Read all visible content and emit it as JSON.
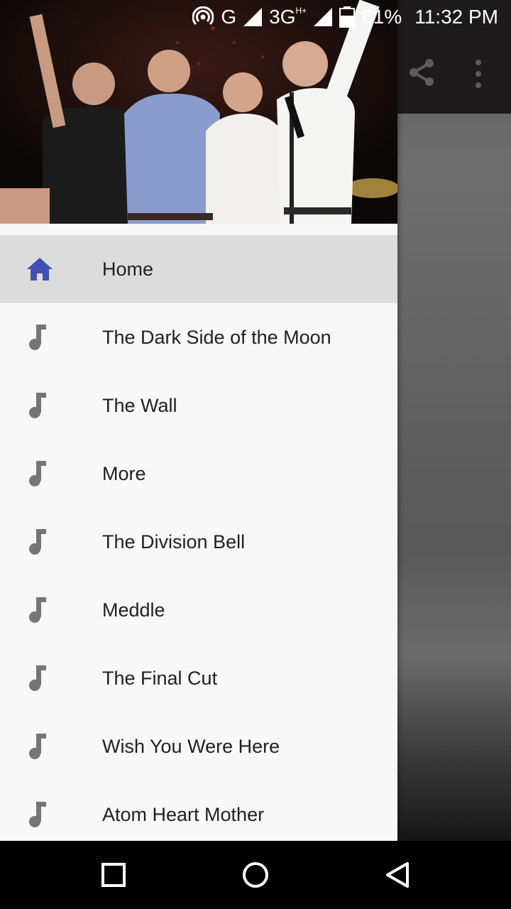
{
  "status_bar": {
    "network_g": "G",
    "network_3g": "3G",
    "network_3g_sup": "H+",
    "battery": "61%",
    "time": "11:32 PM"
  },
  "colors": {
    "accent": "#3f51b5",
    "icon_gray": "#757575",
    "active_bg": "#dcdcdc",
    "drawer_bg": "#f8f8f8"
  },
  "header": {
    "image": "band-photo"
  },
  "drawer": {
    "items": [
      {
        "label": "Home",
        "icon": "home-icon",
        "active": true
      },
      {
        "label": "The Dark Side of the Moon",
        "icon": "music-note-icon",
        "active": false
      },
      {
        "label": "The Wall",
        "icon": "music-note-icon",
        "active": false
      },
      {
        "label": "More",
        "icon": "music-note-icon",
        "active": false
      },
      {
        "label": "The Division Bell",
        "icon": "music-note-icon",
        "active": false
      },
      {
        "label": "Meddle",
        "icon": "music-note-icon",
        "active": false
      },
      {
        "label": "The Final Cut",
        "icon": "music-note-icon",
        "active": false
      },
      {
        "label": "Wish You Were Here",
        "icon": "music-note-icon",
        "active": false
      },
      {
        "label": "Atom Heart Mother",
        "icon": "music-note-icon",
        "active": false
      }
    ]
  },
  "app_bar": {
    "actions": [
      "share-icon",
      "more-vert-icon"
    ]
  },
  "nav_bar": {
    "buttons": [
      "recents-button",
      "home-button",
      "back-button"
    ]
  }
}
